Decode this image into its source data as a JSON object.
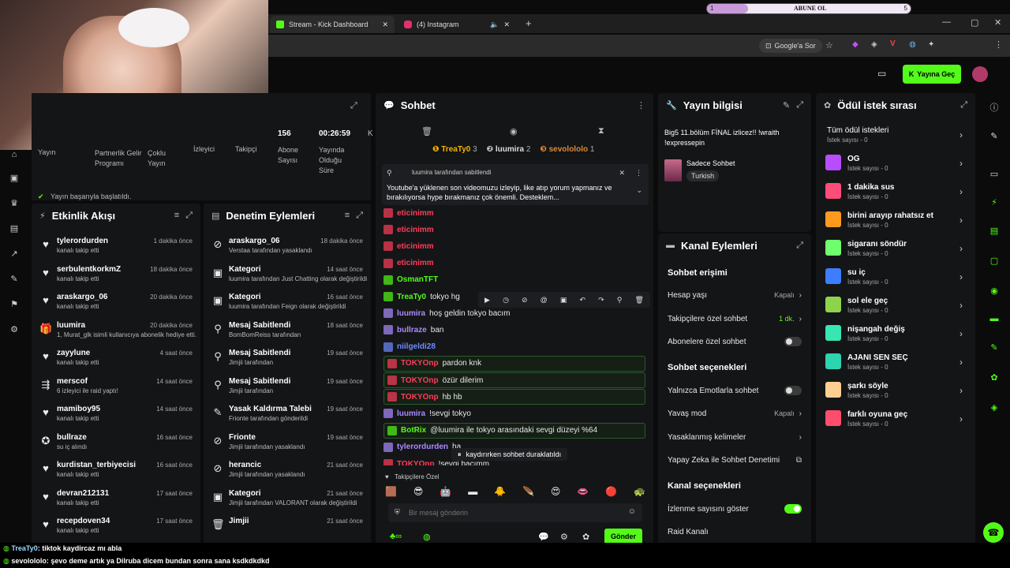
{
  "overlay": {
    "sub_goal_left": "1",
    "sub_goal_label": "ABUNE OL",
    "sub_goal_right": "5"
  },
  "browser": {
    "tabs": [
      {
        "label": "Stream - Kick Dashboard"
      },
      {
        "label": "(4) Instagram"
      }
    ],
    "ask_google": "Google'a Sor"
  },
  "header": {
    "go_live": "Yayına Geç"
  },
  "stats": {
    "followers": "156",
    "followers_label": "Abone Sayısı",
    "uptime": "00:26:59",
    "uptime_label": "Yayında Olduğu Süre",
    "partner_label": "Partnerlik Gelir Programı",
    "multistream_label": "Çoklu Yayın",
    "stream_label": "Yayın",
    "viewers_label": "İzleyici",
    "follow_label": "Takipçi",
    "cut_label": "K",
    "success_msg": "Yayın başarıyla başlatıldı."
  },
  "activity": {
    "title": "Etkinlik Akışı",
    "items": [
      {
        "name": "tylerordurden",
        "time": "1 dakika önce",
        "sub": "kanalı takip etti",
        "icon": "♥"
      },
      {
        "name": "serbulentkorkmZ",
        "time": "18 dakika önce",
        "sub": "kanalı takip etti",
        "icon": "♥"
      },
      {
        "name": "araskargo_06",
        "time": "20 dakika önce",
        "sub": "kanalı takip etti",
        "icon": "♥"
      },
      {
        "name": "luumira",
        "time": "20 dakika önce",
        "sub": "1, Murat_glk isimli kullanıcıya abonelik hediye etti.",
        "icon": "🎁"
      },
      {
        "name": "zayylune",
        "time": "4 saat önce",
        "sub": "kanalı takip etti",
        "icon": "♥"
      },
      {
        "name": "merscof",
        "time": "14 saat önce",
        "sub": "6 izleyici ile raid yaptı!",
        "icon": "⇶"
      },
      {
        "name": "mamiboy95",
        "time": "14 saat önce",
        "sub": "kanalı takip etti",
        "icon": "♥"
      },
      {
        "name": "bullraze",
        "time": "16 saat önce",
        "sub": "su iç alındı",
        "icon": "✪"
      },
      {
        "name": "kurdistan_terbiyecisi",
        "time": "16 saat önce",
        "sub": "kanalı takip etti",
        "icon": "♥"
      },
      {
        "name": "devran212131",
        "time": "17 saat önce",
        "sub": "kanalı takip etti",
        "icon": "♥"
      },
      {
        "name": "recepdoven34",
        "time": "17 saat önce",
        "sub": "kanalı takip etti",
        "icon": "♥"
      }
    ]
  },
  "moderation": {
    "title": "Denetim Eylemleri",
    "items": [
      {
        "name": "araskargo_06",
        "time": "18 dakika önce",
        "sub": "Verstaa tarafından yasaklandı",
        "icon": "⊘"
      },
      {
        "name": "Kategori",
        "time": "14 saat önce",
        "sub": "luumira tarafından Just Chatting olarak değiştirildi",
        "icon": "▣"
      },
      {
        "name": "Kategori",
        "time": "16 saat önce",
        "sub": "luumira tarafından Feign olarak değiştirildi",
        "icon": "▣"
      },
      {
        "name": "Mesaj Sabitlendi",
        "time": "18 saat önce",
        "sub": "BomBomReiss tarafından",
        "icon": "⚲"
      },
      {
        "name": "Mesaj Sabitlendi",
        "time": "19 saat önce",
        "sub": "Jimjii tarafından",
        "icon": "⚲"
      },
      {
        "name": "Mesaj Sabitlendi",
        "time": "19 saat önce",
        "sub": "Jimjii tarafından",
        "icon": "⚲"
      },
      {
        "name": "Yasak Kaldırma Talebi",
        "time": "19 saat önce",
        "sub": "Frionte tarafından gönderildi",
        "icon": "✎"
      },
      {
        "name": "Frionte",
        "time": "19 saat önce",
        "sub": "Jimjii tarafından yasaklandı",
        "icon": "⊘"
      },
      {
        "name": "herancic",
        "time": "21 saat önce",
        "sub": "Jimjii tarafından yasaklandı",
        "icon": "⊘"
      },
      {
        "name": "Kategori",
        "time": "21 saat önce",
        "sub": "Jimjii tarafından VALORANT olarak değiştirildi",
        "icon": "▣"
      },
      {
        "name": "Jimjii",
        "time": "21 saat önce",
        "sub": "",
        "icon": "🗑"
      }
    ]
  },
  "chat": {
    "title": "Sohbet",
    "top_gifters": [
      {
        "name": "TreaTy0",
        "count": "3"
      },
      {
        "name": "luumira",
        "count": "2"
      },
      {
        "name": "sevolololo",
        "count": "1"
      }
    ],
    "pinned_by": "luumira tarafından sabitlendi",
    "pinned_text": "Youtube'a yüklenen son videomuzu izleyip, like atıp yorum yapmanız ve bırakılıyorsa hype bırakmanız çok önemli. Desteklem...",
    "messages": [
      {
        "user": "eticinimm",
        "text": "",
        "color": "#ff3d5a"
      },
      {
        "user": "eticinimm",
        "text": "",
        "color": "#ff3d5a"
      },
      {
        "user": "eticinimm",
        "text": "",
        "color": "#ff3d5a"
      },
      {
        "user": "eticinimm",
        "text": "",
        "color": "#ff3d5a"
      },
      {
        "user": "OsmanTFT",
        "text": "",
        "color": "#53fc18"
      },
      {
        "user": "TreaTy0",
        "text": "tokyo hg",
        "color": "#53fc18"
      },
      {
        "user": "luumira",
        "text": "hoş geldin tokyo bacım",
        "color": "#a98bff"
      },
      {
        "user": "bullraze",
        "text": "ban",
        "color": "#a98bff"
      },
      {
        "user": "niilgeldi28",
        "text": "",
        "color": "#6f8cff"
      },
      {
        "user": "TOKYOnp",
        "text": "pardon knk",
        "color": "#ff3d5a"
      },
      {
        "user": "TOKYOnp",
        "text": "özür dilerim",
        "color": "#ff3d5a"
      },
      {
        "user": "TOKYOnp",
        "text": "hb hb",
        "color": "#ff3d5a"
      },
      {
        "user": "luumira",
        "text": "!sevgi tokyo",
        "color": "#a98bff"
      },
      {
        "user": "BotRix",
        "text": "@luumira ile tokyo arasındaki sevgi düzeyi %64",
        "color": "#53fc18"
      },
      {
        "user": "tylerordurden",
        "text": "ha",
        "color": "#a98bff"
      },
      {
        "user": "TOKYOnp",
        "text": "!sevgi bacımm",
        "color": "#ff3d5a"
      }
    ],
    "paused": "kaydırırken sohbet duraklatıldı",
    "emote_label": "Takipçilere Özel",
    "placeholder": "Bir mesaj gönderin",
    "send": "Gönder"
  },
  "stream_info": {
    "title": "Yayın bilgisi",
    "stream_title": "Big5 11.bölüm FİNAL izlicez!! !wraith !expressepin",
    "category": "Sadece Sohbet",
    "language": "Turkish"
  },
  "channel_actions": {
    "title": "Kanal Eylemleri",
    "chat_access": "Sohbet erişimi",
    "account_age": "Hesap yaşı",
    "account_age_val": "Kapalı",
    "followers_only": "Takipçilere özel sohbet",
    "followers_only_val": "1 dk.",
    "subs_only": "Abonelere özel sohbet",
    "chat_options": "Sohbet seçenekleri",
    "emote_only": "Yalnızca Emotlarla sohbet",
    "slow_mode": "Yavaş mod",
    "slow_mode_val": "Kapalı",
    "banned_words": "Yasaklanmış kelimeler",
    "ai_mod": "Yapay Zeka ile Sohbet Denetimi",
    "channel_options": "Kanal seçenekleri",
    "show_viewers": "İzlenme sayısını göster",
    "raid": "Raid Kanalı"
  },
  "rewards": {
    "title": "Ödül istek sırası",
    "all": "Tüm ödül istekleri",
    "all_count": "İstek sayısı - 0",
    "items": [
      {
        "name": "OG",
        "count": "İstek sayısı - 0",
        "color": "#b84dff"
      },
      {
        "name": "1 dakika sus",
        "count": "İstek sayısı - 0",
        "color": "#ff4d7a"
      },
      {
        "name": "birini arayıp rahatsız et",
        "count": "İstek sayısı - 0",
        "color": "#ff9a1f"
      },
      {
        "name": "sigaranı söndür",
        "count": "İstek sayısı - 0",
        "color": "#6dff6d"
      },
      {
        "name": "su iç",
        "count": "İstek sayısı - 0",
        "color": "#3d7dff"
      },
      {
        "name": "sol ele geç",
        "count": "İstek sayısı - 0",
        "color": "#8ed44b"
      },
      {
        "name": "nişangah değiş",
        "count": "İstek sayısı - 0",
        "color": "#38e6b2"
      },
      {
        "name": "AJANI SEN SEÇ",
        "count": "İstek sayısı - 0",
        "color": "#2ed3b0"
      },
      {
        "name": "şarkı söyle",
        "count": "İstek sayısı - 0",
        "color": "#ffcf91"
      },
      {
        "name": "farklı oyuna geç",
        "count": "İstek sayısı - 0",
        "color": "#ff4d6d"
      }
    ]
  },
  "ticker": {
    "line1_user": "TreaTy0",
    "line1_text": ": tiktok kaydircaz mı abla",
    "line2_user": "sevolololo",
    "line2_text": ": şevo deme artık ya Dilruba dicem bundan sonra sana ksdkdkdkd"
  }
}
